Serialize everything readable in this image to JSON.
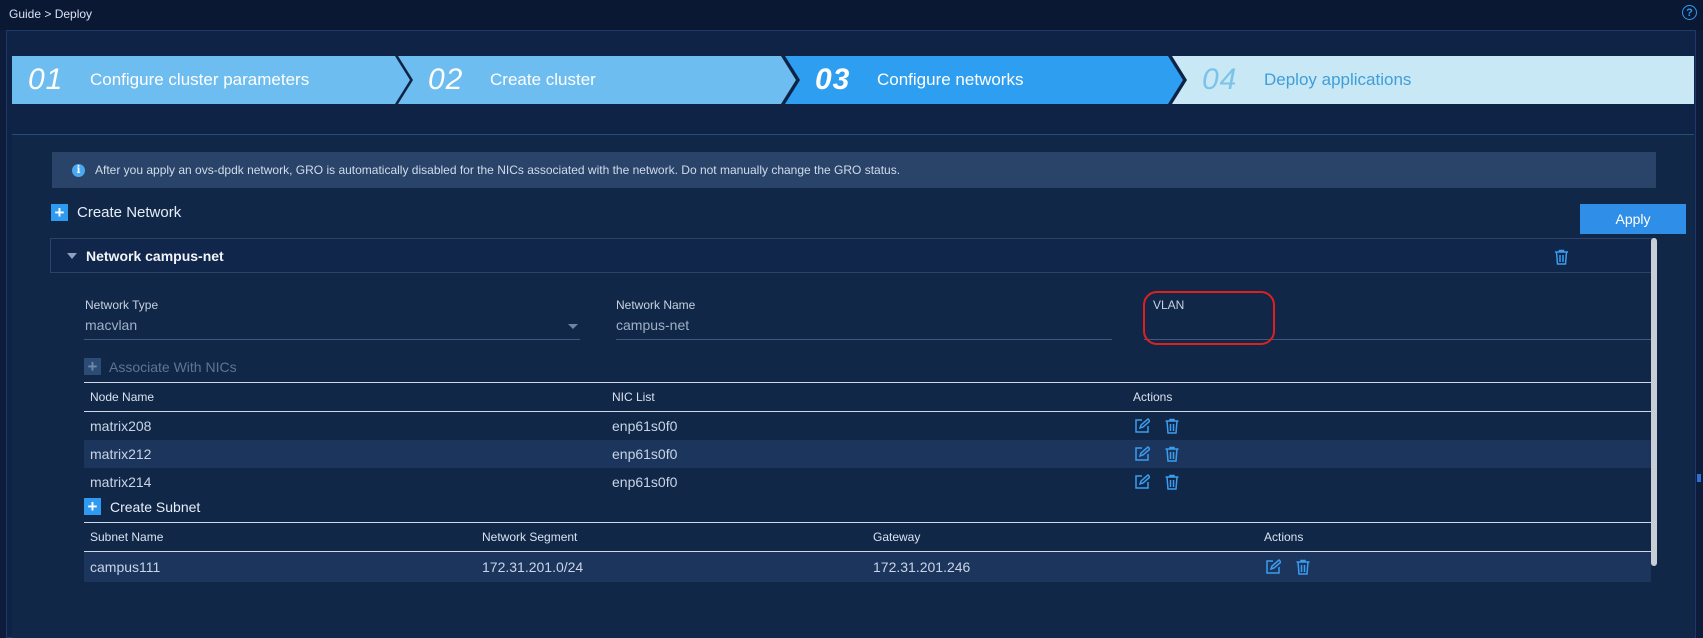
{
  "breadcrumb": "Guide > Deploy",
  "help_icon": "question-circle-icon",
  "steps": [
    {
      "num": "01",
      "label": "Configure cluster parameters",
      "state": "done"
    },
    {
      "num": "02",
      "label": "Create cluster",
      "state": "done"
    },
    {
      "num": "03",
      "label": "Configure networks",
      "state": "active"
    },
    {
      "num": "04",
      "label": "Deploy applications",
      "state": "pending"
    }
  ],
  "notice": "After you apply an ovs-dpdk network, GRO is automatically disabled for the NICs associated with the network. Do not manually change the GRO status.",
  "create_network": "Create Network",
  "apply": "Apply",
  "network": {
    "title": "Network campus-net",
    "type_label": "Network Type",
    "type_value": "macvlan",
    "name_label": "Network Name",
    "name_value": "campus-net",
    "vlan_label": "VLAN",
    "vlan_value": ""
  },
  "associate": "Associate With NICs",
  "nic_table": {
    "headers": [
      "Node Name",
      "NIC List",
      "Actions"
    ],
    "rows": [
      {
        "node": "matrix208",
        "nic": "enp61s0f0"
      },
      {
        "node": "matrix212",
        "nic": "enp61s0f0"
      },
      {
        "node": "matrix214",
        "nic": "enp61s0f0"
      }
    ]
  },
  "create_subnet": "Create Subnet",
  "subnet_table": {
    "headers": [
      "Subnet Name",
      "Network Segment",
      "Gateway",
      "Actions"
    ],
    "rows": [
      {
        "name": "campus111",
        "segment": "172.31.201.0/24",
        "gateway": "172.31.201.246"
      }
    ]
  },
  "colors": {
    "background": "#0d1c3a",
    "step_done": "#6ebdf0",
    "step_active": "#2e9ef0",
    "step_pending": "#c9e8f6",
    "accent": "#2f9bf0",
    "annotation": "#e0201e"
  }
}
